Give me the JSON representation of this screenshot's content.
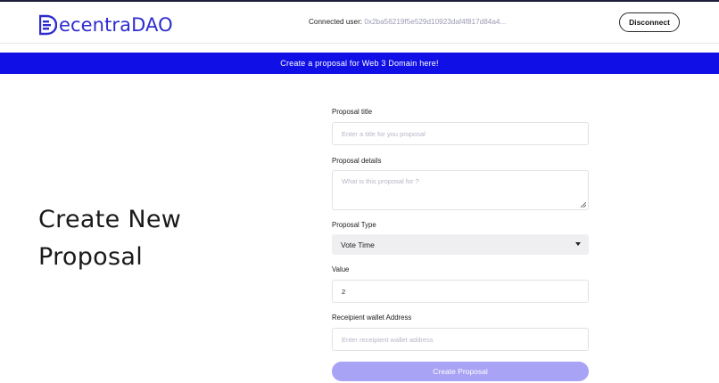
{
  "header": {
    "logo_text": "ecentraDAO",
    "logo_icon": "letter-d-icon",
    "connected_label": "Connected user: ",
    "connected_address": "0x2ba56219f5e529d10923daf4f817d84a4...",
    "disconnect_label": "Disconnect"
  },
  "banner": {
    "text": "Create a proposal for Web 3 Domain here!"
  },
  "main": {
    "title": "Create New Proposal"
  },
  "form": {
    "title_label": "Proposal title",
    "title_placeholder": "Enter a title for you proposal",
    "details_label": "Proposal details",
    "details_placeholder": "What is this proposal for ?",
    "type_label": "Proposal Type",
    "type_selected": "Vote Time",
    "value_label": "Value",
    "value_value": "2",
    "recipient_label": "Receipient wallet Address",
    "recipient_placeholder": "Enter receipient wallet address",
    "submit_label": "Create Proposal"
  },
  "colors": {
    "brand": "#2d2ccf",
    "banner": "#1010e6",
    "submit": "#a8a3f4"
  }
}
